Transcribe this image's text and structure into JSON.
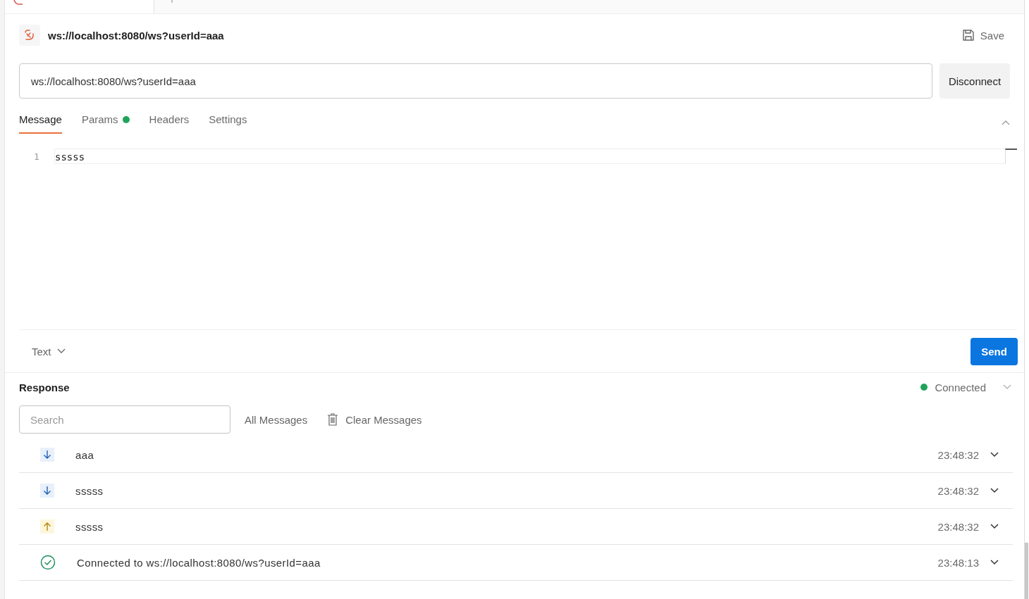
{
  "request": {
    "title": "ws://localhost:8080/ws?userId=aaa",
    "save_label": "Save"
  },
  "url_bar": {
    "value": "ws://localhost:8080/ws?userId=aaa",
    "button": "Disconnect"
  },
  "tabs": [
    {
      "label": "Message",
      "selected": true,
      "indicator": false
    },
    {
      "label": "Params",
      "selected": false,
      "indicator": true
    },
    {
      "label": "Headers",
      "selected": false,
      "indicator": false
    },
    {
      "label": "Settings",
      "selected": false,
      "indicator": false
    }
  ],
  "editor": {
    "lines": [
      {
        "number": "1",
        "text": "sssss"
      }
    ]
  },
  "message_footer": {
    "format": "Text",
    "send_button": "Send"
  },
  "response": {
    "title": "Response",
    "status": "Connected",
    "connected": true,
    "search": {
      "placeholder": "Search"
    },
    "filter": "All Messages",
    "clear_button": "Clear Messages",
    "messages": [
      {
        "kind": "incoming",
        "text": "aaa",
        "time": "23:48:32"
      },
      {
        "kind": "incoming",
        "text": "sssss",
        "time": "23:48:32"
      },
      {
        "kind": "outgoing",
        "text": "sssss",
        "time": "23:48:32"
      },
      {
        "kind": "connected",
        "text": "Connected to ws://localhost:8080/ws?userId=aaa",
        "time": "23:48:13"
      }
    ]
  }
}
